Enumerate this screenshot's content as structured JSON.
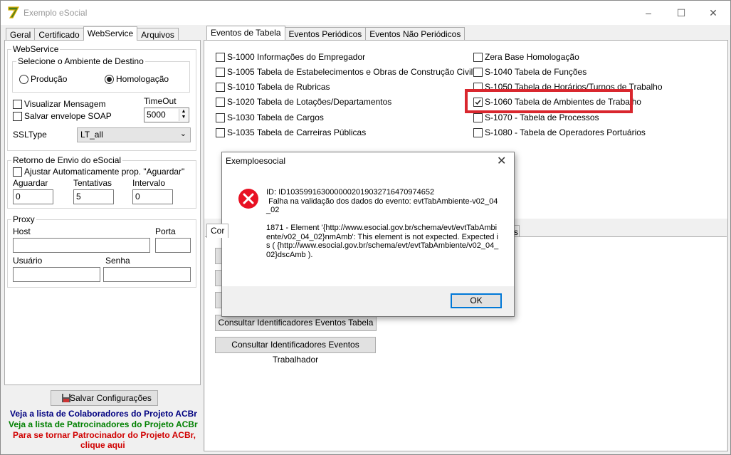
{
  "window": {
    "title": "Exemplo eSocial",
    "controls": [
      "–",
      "☐",
      "✕"
    ]
  },
  "left": {
    "tabs": [
      "Geral",
      "Certificado",
      "WebService",
      "Arquivos"
    ],
    "webservice": {
      "group_title": "WebService",
      "env_title": "Selecione o Ambiente de Destino",
      "radio_producao": "Produção",
      "radio_homologacao": "Homologação",
      "selected": "Homologação",
      "chk_visualizar": "Visualizar Mensagem",
      "chk_salvar": "Salvar envelope SOAP",
      "timeout_label": "TimeOut",
      "timeout_value": "5000",
      "ssltype_label": "SSLType",
      "ssltype_value": "LT_all"
    },
    "retorno": {
      "group_title": "Retorno de Envio do eSocial",
      "chk_ajustar": "Ajustar Automaticamente prop. \"Aguardar\"",
      "aguardar_label": "Aguardar",
      "aguardar_value": "0",
      "tentativas_label": "Tentativas",
      "tentativas_value": "5",
      "intervalo_label": "Intervalo",
      "intervalo_value": "0"
    },
    "proxy": {
      "group_title": "Proxy",
      "host_label": "Host",
      "porta_label": "Porta",
      "usuario_label": "Usuário",
      "senha_label": "Senha"
    },
    "save_button": "Salvar Configurações",
    "links": {
      "colaboradores": "Veja a lista de Colaboradores do Projeto ACBr",
      "patrocinadores": "Veja a lista de Patrocinadores do Projeto ACBr",
      "tornar_line1": "Para se tornar Patrocinador do Projeto ACBr,",
      "tornar_line2": "clique aqui"
    },
    "colors": {
      "colaboradores": "#000080",
      "patrocinadores": "#008000",
      "tornar": "#d00000"
    }
  },
  "right": {
    "tabs": [
      "Eventos de Tabela",
      "Eventos Periódicos",
      "Eventos Não Periódicos"
    ],
    "events_left": [
      {
        "label": "S-1000 Informações do Empregador",
        "checked": false
      },
      {
        "label": "S-1005 Tabela de Estabelecimentos e Obras de Construção Civil",
        "checked": false
      },
      {
        "label": "S-1010 Tabela de Rubricas",
        "checked": false
      },
      {
        "label": "S-1020 Tabela de Lotações/Departamentos",
        "checked": false
      },
      {
        "label": "S-1030 Tabela de Cargos",
        "checked": false
      },
      {
        "label": "S-1035 Tabela de Carreiras Públicas",
        "checked": false
      }
    ],
    "events_right": [
      {
        "label": "Zera Base Homologação",
        "checked": false
      },
      {
        "label": "S-1040 Tabela de Funções",
        "checked": false
      },
      {
        "label": "S-1050 Tabela de Horários/Turnos de Trabalho",
        "checked": false
      },
      {
        "label": "S-1060 Tabela de Ambientes de Trabalho",
        "checked": true
      },
      {
        "label": "S-1070 - Tabela de Processos",
        "checked": false
      },
      {
        "label": "S-1080 - Tabela de Operadores Portuários",
        "checked": false
      }
    ],
    "lower_tab_fragment": "Cor",
    "lower_tab_fragment2": "s",
    "btn_consultar_tabela": "Consultar Identificadores Eventos Tabela",
    "btn_consultar_trabalhador": "Consultar Identificadores Eventos Trabalhador"
  },
  "dialog": {
    "title": "Exemploesocial",
    "message": "ID: ID1035991630000002019032716470974652\n Falha na validação dos dados do evento: evtTabAmbiente-v02_04_02\n\n1871 - Element '{http://www.esocial.gov.br/schema/evt/evtTabAmbiente/v02_04_02}nmAmb': This element is not expected. Expected is ( {http://www.esocial.gov.br/schema/evt/evtTabAmbiente/v02_04_02}dscAmb ).",
    "ok": "OK",
    "icon": "error-icon",
    "accent": "#e81123"
  }
}
